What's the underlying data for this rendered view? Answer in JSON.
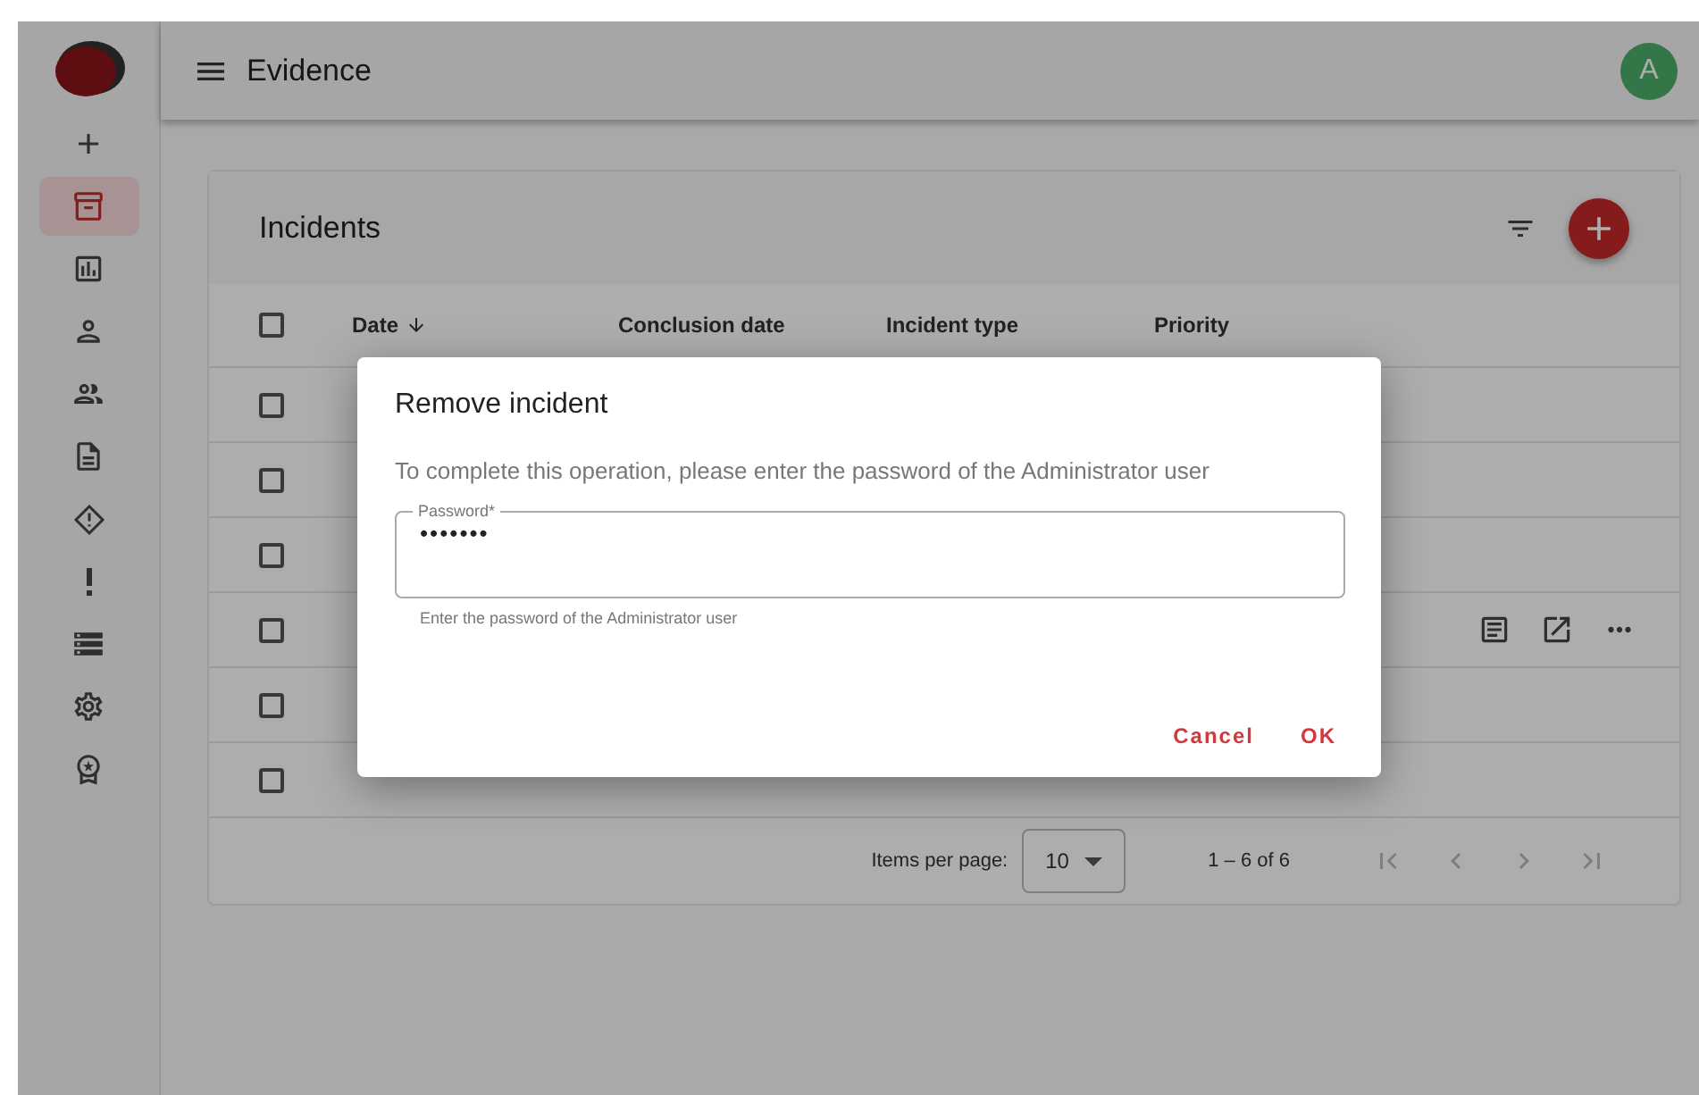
{
  "sidebar": {
    "items": [
      {
        "selected": false
      },
      {
        "selected": true
      },
      {
        "selected": false
      },
      {
        "selected": false
      },
      {
        "selected": false
      },
      {
        "selected": false
      },
      {
        "selected": false
      },
      {
        "selected": false
      },
      {
        "selected": false
      },
      {
        "selected": false
      },
      {
        "selected": false
      }
    ]
  },
  "header": {
    "title": "Evidence",
    "avatar": "A"
  },
  "card": {
    "title": "Incidents"
  },
  "table": {
    "columns": [
      {
        "label": "Date",
        "sorted": true
      },
      {
        "label": "Conclusion date",
        "sorted": false
      },
      {
        "label": "Incident type",
        "sorted": false
      },
      {
        "label": "Priority",
        "sorted": false
      }
    ],
    "rows": [
      {
        "checked": false,
        "actions": false
      },
      {
        "checked": false,
        "actions": false
      },
      {
        "checked": false,
        "actions": false
      },
      {
        "checked": false,
        "actions": true
      },
      {
        "checked": false,
        "actions": false
      },
      {
        "checked": false,
        "actions": false
      }
    ],
    "all_checked": false
  },
  "paginator": {
    "label": "Items per page:",
    "page_size": "10",
    "range": "1 – 6 of 6"
  },
  "dialog": {
    "title": "Remove incident",
    "message": "To complete this operation, please enter the password of the Administrator user",
    "field": {
      "label": "Password*",
      "value": "•••••••",
      "hint": "Enter the password of the Administrator user"
    },
    "buttons": [
      "Cancel",
      "OK"
    ]
  }
}
